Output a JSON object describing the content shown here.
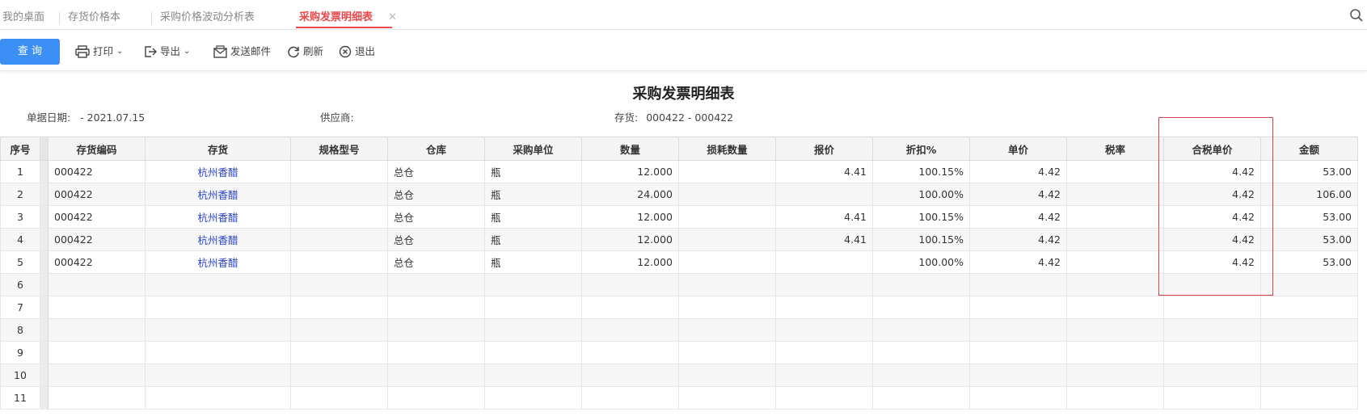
{
  "tabs": [
    {
      "label": "我的桌面",
      "active": false
    },
    {
      "label": "存货价格本",
      "active": false
    },
    {
      "label": "采购价格波动分析表",
      "active": false
    },
    {
      "label": "采购发票明细表",
      "active": true
    }
  ],
  "toolbar": {
    "query": "查 询",
    "print": "打印",
    "export": "导出",
    "send_mail": "发送邮件",
    "refresh": "刷新",
    "exit": "退出"
  },
  "report": {
    "title": "采购发票明细表",
    "filters": {
      "date_label": "单据日期:",
      "date_value": "- 2021.07.15",
      "supplier_label": "供应商:",
      "supplier_value": "",
      "inventory_label": "存货:",
      "inventory_value": "000422 - 000422"
    }
  },
  "table": {
    "columns": [
      "序号",
      "存货编码",
      "存货",
      "规格型号",
      "仓库",
      "采购单位",
      "数量",
      "损耗数量",
      "报价",
      "折扣%",
      "单价",
      "税率",
      "合税单价",
      "金额"
    ],
    "rows": [
      {
        "idx": "1",
        "code": "000422",
        "item": "杭州香醋",
        "spec": "",
        "warehouse": "总仓",
        "unit": "瓶",
        "qty": "12.000",
        "loss": "",
        "quote": "4.41",
        "discount": "100.15%",
        "price": "4.42",
        "tax": "",
        "taxprice": "4.42",
        "amount": "53.00"
      },
      {
        "idx": "2",
        "code": "000422",
        "item": "杭州香醋",
        "spec": "",
        "warehouse": "总仓",
        "unit": "瓶",
        "qty": "24.000",
        "loss": "",
        "quote": "",
        "discount": "100.00%",
        "price": "4.42",
        "tax": "",
        "taxprice": "4.42",
        "amount": "106.00"
      },
      {
        "idx": "3",
        "code": "000422",
        "item": "杭州香醋",
        "spec": "",
        "warehouse": "总仓",
        "unit": "瓶",
        "qty": "12.000",
        "loss": "",
        "quote": "4.41",
        "discount": "100.15%",
        "price": "4.42",
        "tax": "",
        "taxprice": "4.42",
        "amount": "53.00"
      },
      {
        "idx": "4",
        "code": "000422",
        "item": "杭州香醋",
        "spec": "",
        "warehouse": "总仓",
        "unit": "瓶",
        "qty": "12.000",
        "loss": "",
        "quote": "4.41",
        "discount": "100.15%",
        "price": "4.42",
        "tax": "",
        "taxprice": "4.42",
        "amount": "53.00"
      },
      {
        "idx": "5",
        "code": "000422",
        "item": "杭州香醋",
        "spec": "",
        "warehouse": "总仓",
        "unit": "瓶",
        "qty": "12.000",
        "loss": "",
        "quote": "",
        "discount": "100.00%",
        "price": "4.42",
        "tax": "",
        "taxprice": "4.42",
        "amount": "53.00"
      },
      {
        "idx": "6",
        "code": "",
        "item": "",
        "spec": "",
        "warehouse": "",
        "unit": "",
        "qty": "",
        "loss": "",
        "quote": "",
        "discount": "",
        "price": "",
        "tax": "",
        "taxprice": "",
        "amount": ""
      },
      {
        "idx": "7",
        "code": "",
        "item": "",
        "spec": "",
        "warehouse": "",
        "unit": "",
        "qty": "",
        "loss": "",
        "quote": "",
        "discount": "",
        "price": "",
        "tax": "",
        "taxprice": "",
        "amount": ""
      },
      {
        "idx": "8",
        "code": "",
        "item": "",
        "spec": "",
        "warehouse": "",
        "unit": "",
        "qty": "",
        "loss": "",
        "quote": "",
        "discount": "",
        "price": "",
        "tax": "",
        "taxprice": "",
        "amount": ""
      },
      {
        "idx": "9",
        "code": "",
        "item": "",
        "spec": "",
        "warehouse": "",
        "unit": "",
        "qty": "",
        "loss": "",
        "quote": "",
        "discount": "",
        "price": "",
        "tax": "",
        "taxprice": "",
        "amount": ""
      },
      {
        "idx": "10",
        "code": "",
        "item": "",
        "spec": "",
        "warehouse": "",
        "unit": "",
        "qty": "",
        "loss": "",
        "quote": "",
        "discount": "",
        "price": "",
        "tax": "",
        "taxprice": "",
        "amount": ""
      },
      {
        "idx": "11",
        "code": "",
        "item": "",
        "spec": "",
        "warehouse": "",
        "unit": "",
        "qty": "",
        "loss": "",
        "quote": "",
        "discount": "",
        "price": "",
        "tax": "",
        "taxprice": "",
        "amount": ""
      }
    ]
  },
  "colors": {
    "accent_red": "#e8484b",
    "query_blue": "#3c8ff5",
    "link_blue": "#2a44c8",
    "highlight_box": "#d9424a"
  },
  "icons": {
    "search": "search-icon",
    "print": "printer-icon",
    "export": "export-icon",
    "mail": "mail-icon",
    "refresh": "refresh-icon",
    "exit": "exit-icon",
    "close": "close-icon"
  }
}
